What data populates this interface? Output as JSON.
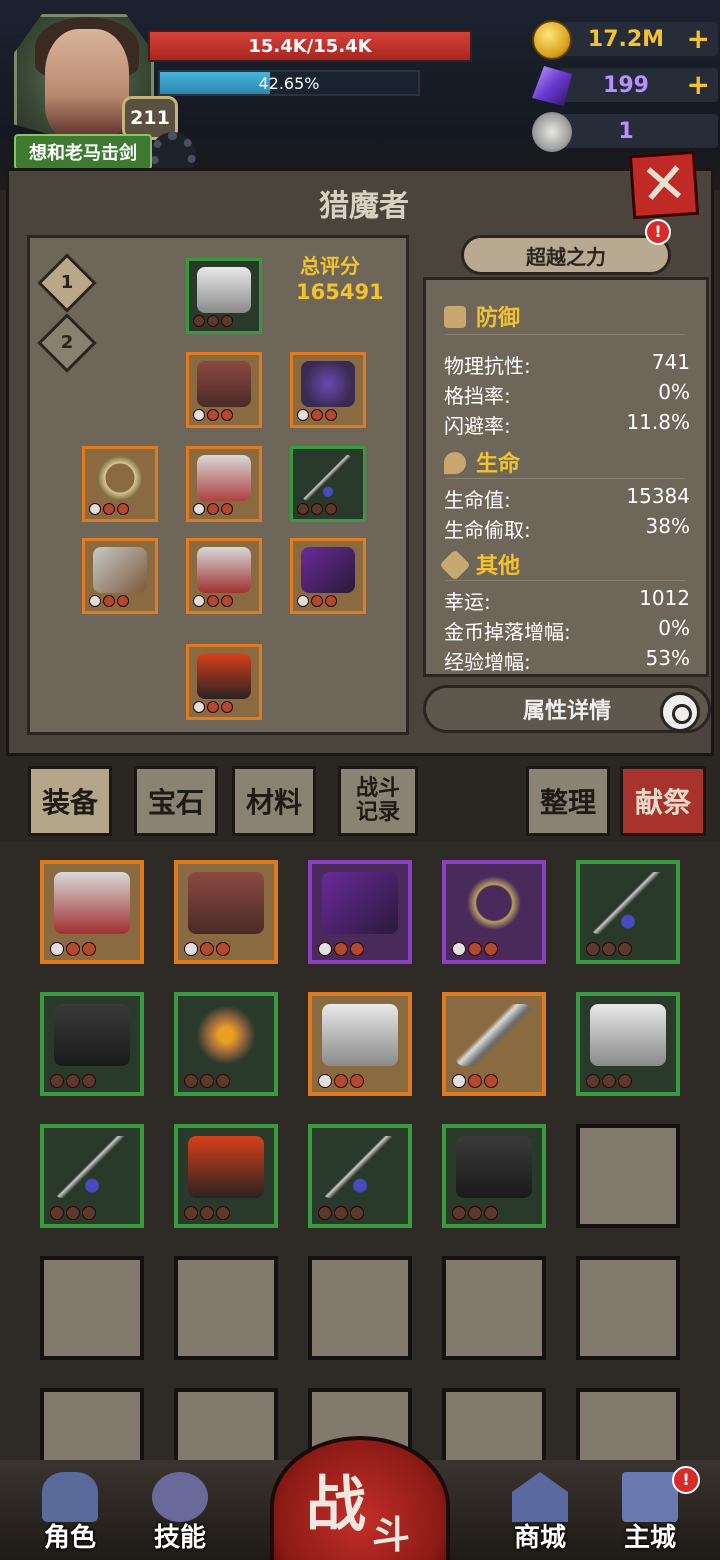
{
  "player": {
    "name": "想和老马击剑",
    "level": "211",
    "hp_text": "15.4K/15.4K",
    "hp_fraction": 1.0,
    "xp_text": "42.65%",
    "xp_fraction": 0.4265
  },
  "currencies": {
    "gold": "17.2M",
    "gems": "199",
    "keys": "1"
  },
  "panel": {
    "title": "猎魔者",
    "score_label": "总评分",
    "score_value": "165491",
    "loadouts": [
      "1",
      "2"
    ],
    "transcend_label": "超越之力",
    "alert": "!",
    "detail_label": "属性详情"
  },
  "stats": {
    "defense": {
      "title": "防御",
      "rows": [
        {
          "k": "物理抗性:",
          "v": "741"
        },
        {
          "k": "格挡率:",
          "v": "0%"
        },
        {
          "k": "闪避率:",
          "v": "11.8%"
        }
      ]
    },
    "life": {
      "title": "生命",
      "rows": [
        {
          "k": "生命值:",
          "v": "15384"
        },
        {
          "k": "生命偷取:",
          "v": "38%"
        }
      ]
    },
    "other": {
      "title": "其他",
      "rows": [
        {
          "k": "幸运:",
          "v": "1012"
        },
        {
          "k": "金币掉落增幅:",
          "v": "0%"
        },
        {
          "k": "经验增幅:",
          "v": "53%"
        }
      ]
    }
  },
  "tabs": {
    "equipment": "装备",
    "gems": "宝石",
    "materials": "材料",
    "battle_record": "战斗\n记录",
    "sort": "整理",
    "sacrifice": "献祭"
  },
  "equipped": [
    {
      "slot": "helmet",
      "rarity": "green",
      "icon": "helmet-icon"
    },
    {
      "slot": "armor",
      "rarity": "orange",
      "icon": "armor-icon"
    },
    {
      "slot": "amulet",
      "rarity": "orange",
      "icon": "amulet-icon"
    },
    {
      "slot": "bracelet",
      "rarity": "orange",
      "icon": "bracelet-icon"
    },
    {
      "slot": "belt",
      "rarity": "orange",
      "icon": "belt-icon"
    },
    {
      "slot": "necklace",
      "rarity": "green",
      "icon": "necklace-icon"
    },
    {
      "slot": "mainhand",
      "rarity": "orange",
      "icon": "axe-icon"
    },
    {
      "slot": "gloves",
      "rarity": "orange",
      "icon": "gloves-icon"
    },
    {
      "slot": "offhand",
      "rarity": "orange",
      "icon": "dagger-icon"
    },
    {
      "slot": "boots",
      "rarity": "orange",
      "icon": "boots-icon"
    }
  ],
  "inventory": [
    {
      "rarity": "orange",
      "icon": "gloves-icon"
    },
    {
      "rarity": "orange",
      "icon": "armor-icon"
    },
    {
      "rarity": "purple",
      "icon": "dagger-icon"
    },
    {
      "rarity": "purple",
      "icon": "whip-icon"
    },
    {
      "rarity": "green",
      "icon": "necklace-icon"
    },
    {
      "rarity": "green",
      "icon": "pants-icon"
    },
    {
      "rarity": "green",
      "icon": "ring-icon"
    },
    {
      "rarity": "orange",
      "icon": "helmet-icon"
    },
    {
      "rarity": "orange",
      "icon": "sword-icon"
    },
    {
      "rarity": "green",
      "icon": "helmet-icon"
    },
    {
      "rarity": "green",
      "icon": "necklace-icon"
    },
    {
      "rarity": "green",
      "icon": "boots-icon"
    },
    {
      "rarity": "green",
      "icon": "necklace-icon"
    },
    {
      "rarity": "green",
      "icon": "pants-icon"
    },
    {
      "rarity": "empty",
      "icon": ""
    },
    {
      "rarity": "empty",
      "icon": ""
    },
    {
      "rarity": "empty",
      "icon": ""
    },
    {
      "rarity": "empty",
      "icon": ""
    },
    {
      "rarity": "empty",
      "icon": ""
    },
    {
      "rarity": "empty",
      "icon": ""
    },
    {
      "rarity": "empty",
      "icon": ""
    },
    {
      "rarity": "empty",
      "icon": ""
    },
    {
      "rarity": "empty",
      "icon": ""
    },
    {
      "rarity": "empty",
      "icon": ""
    },
    {
      "rarity": "empty",
      "icon": ""
    }
  ],
  "nav": {
    "character": "角色",
    "skills": "技能",
    "battle_1": "战",
    "battle_2": "斗",
    "shop": "商城",
    "main_city": "主城",
    "alert": "!"
  },
  "colors": {
    "hp": "#c8322c",
    "xp": "#3aa0c8",
    "gold_accent": "#f2c230",
    "rarity_orange": "#e07a20",
    "rarity_green": "#3a9a40",
    "rarity_purple": "#8a40c0"
  }
}
